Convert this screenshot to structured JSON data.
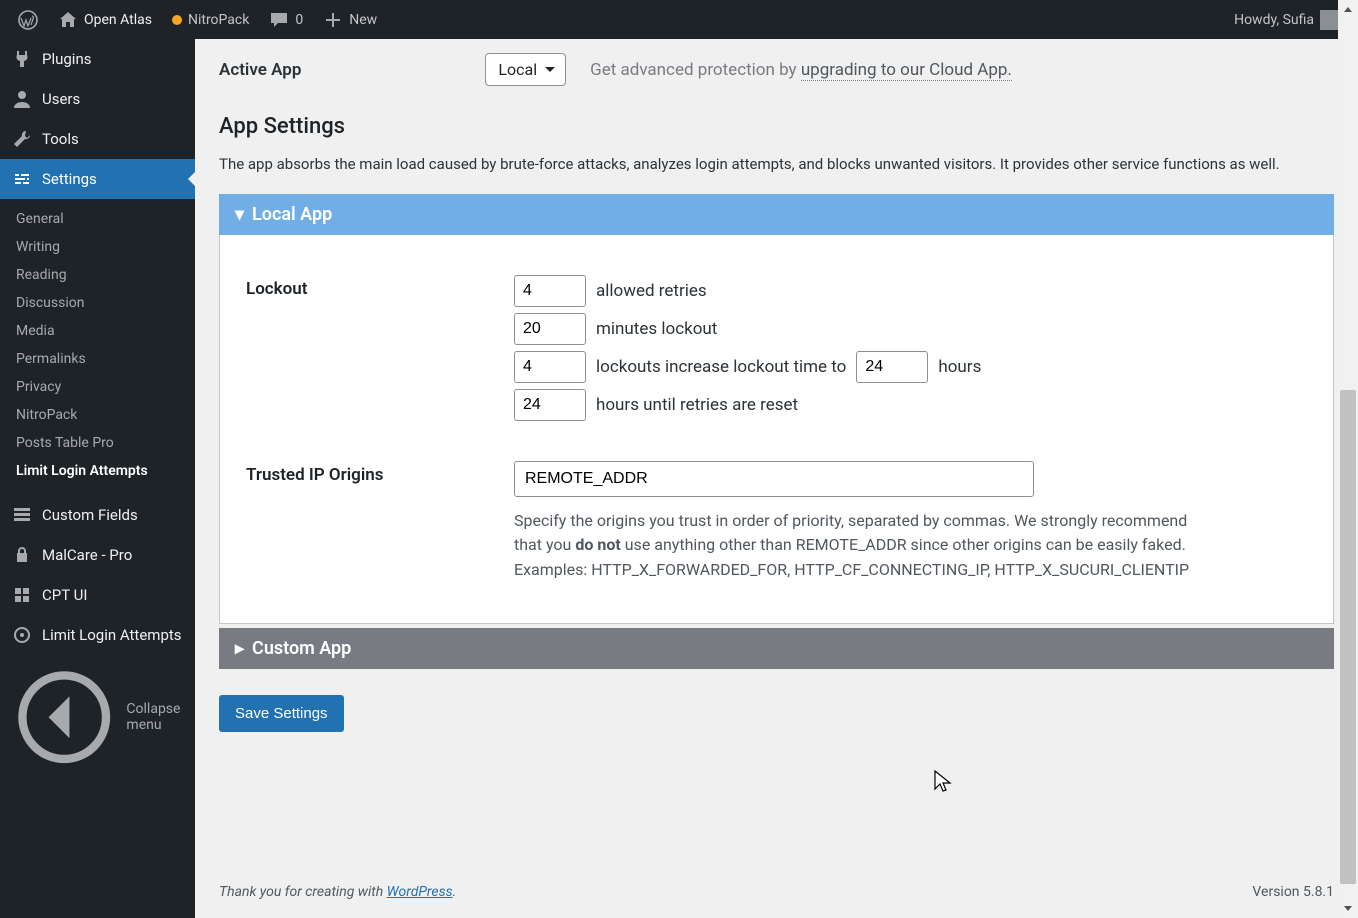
{
  "adminbar": {
    "site": "Open Atlas",
    "nitropack": "NitroPack",
    "comments": "0",
    "new": "New",
    "howdy": "Howdy, Sufia"
  },
  "sidebar": {
    "main": [
      {
        "label": "Plugins"
      },
      {
        "label": "Users"
      },
      {
        "label": "Tools"
      },
      {
        "label": "Settings"
      }
    ],
    "submenu": [
      {
        "label": "General"
      },
      {
        "label": "Writing"
      },
      {
        "label": "Reading"
      },
      {
        "label": "Discussion"
      },
      {
        "label": "Media"
      },
      {
        "label": "Permalinks"
      },
      {
        "label": "Privacy"
      },
      {
        "label": "NitroPack"
      },
      {
        "label": "Posts Table Pro"
      },
      {
        "label": "Limit Login Attempts"
      }
    ],
    "bottom": [
      {
        "label": "Custom Fields"
      },
      {
        "label": "MalCare - Pro"
      },
      {
        "label": "CPT UI"
      },
      {
        "label": "Limit Login Attempts"
      }
    ],
    "collapse": "Collapse menu"
  },
  "page": {
    "active_app_label": "Active App",
    "active_app_value": "Local",
    "promo_prefix": "Get advanced protection by ",
    "promo_link": "upgrading to our Cloud App.",
    "heading": "App Settings",
    "description": "The app absorbs the main load caused by brute-force attacks, analyzes login attempts, and blocks unwanted visitors. It provides other service functions as well.",
    "panel_local": "Local App",
    "panel_custom": "Custom App",
    "lockout_label": "Lockout",
    "lockout": {
      "retries": "4",
      "retries_text": "allowed retries",
      "minutes": "20",
      "minutes_text": "minutes lockout",
      "lockouts": "4",
      "lockouts_text1": "lockouts increase lockout time to",
      "hours": "24",
      "lockouts_text2": "hours",
      "reset": "24",
      "reset_text": "hours until retries are reset"
    },
    "trusted_label": "Trusted IP Origins",
    "trusted_value": "REMOTE_ADDR",
    "trusted_help_a": "Specify the origins you trust in order of priority, separated by commas. We strongly recommend that you ",
    "trusted_help_b": "do not",
    "trusted_help_c": " use anything other than REMOTE_ADDR since other origins can be easily faked. Examples: HTTP_X_FORWARDED_FOR, HTTP_CF_CONNECTING_IP, HTTP_X_SUCURI_CLIENTIP",
    "save": "Save Settings"
  },
  "footer": {
    "thanks_a": "Thank you for creating with ",
    "wp": "WordPress",
    "period": ".",
    "version": "Version 5.8.1"
  }
}
